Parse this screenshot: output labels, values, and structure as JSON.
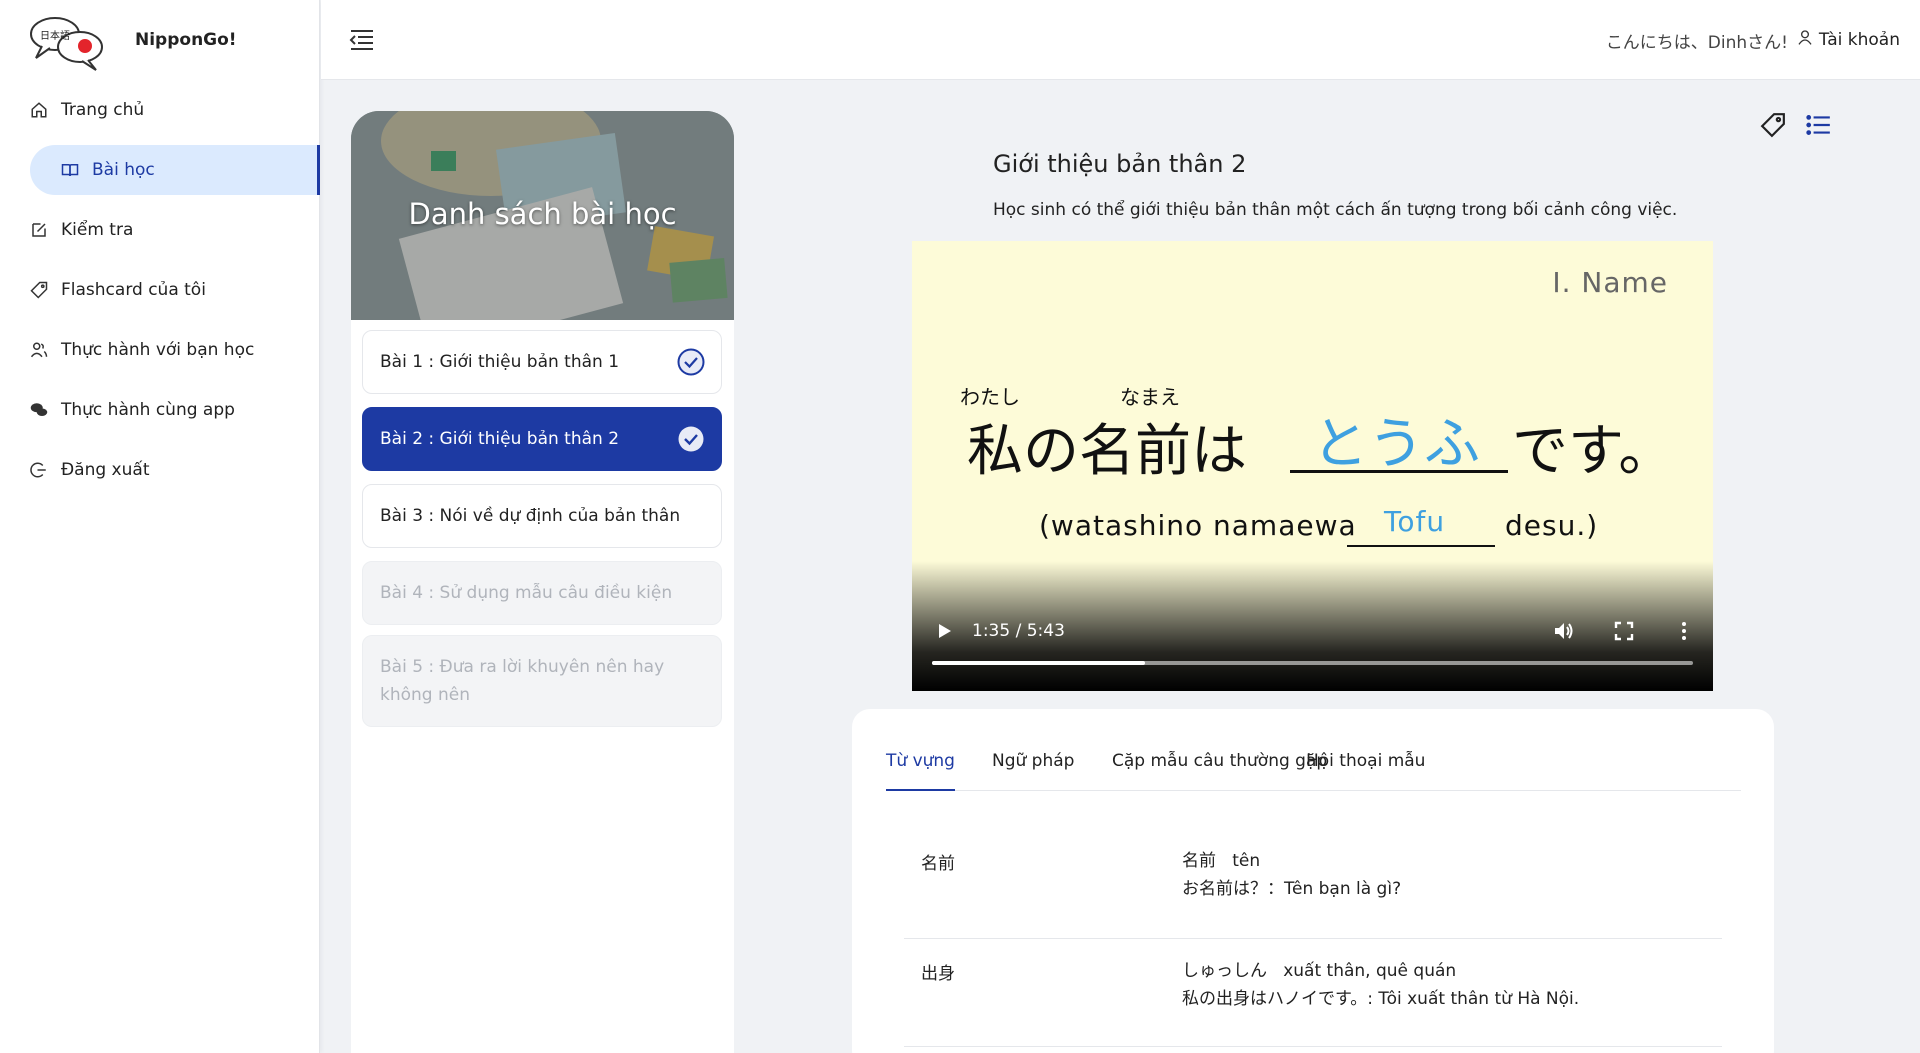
{
  "app": {
    "name": "NipponGo!",
    "logo_text": "日本語"
  },
  "sidebar": {
    "items": [
      {
        "label": "Trang chủ",
        "icon": "home-icon"
      },
      {
        "label": "Bài học",
        "icon": "book-icon",
        "active": true
      },
      {
        "label": "Kiểm tra",
        "icon": "edit-icon"
      },
      {
        "label": "Flashcard của tôi",
        "icon": "tag-icon"
      },
      {
        "label": "Thực hành với bạn học",
        "icon": "users-icon"
      },
      {
        "label": "Thực hành cùng app",
        "icon": "chat-icon"
      },
      {
        "label": "Đăng xuất",
        "icon": "logout-icon"
      }
    ]
  },
  "header": {
    "greeting": "こんにちは、Dinhさん!",
    "account_label": "Tài khoản"
  },
  "lesson_list": {
    "title": "Danh sách bài học",
    "lessons": [
      {
        "label": "Bài 1 : Giới thiệu bản thân 1",
        "status": "completed"
      },
      {
        "label": "Bài 2 : Giới thiệu bản thân 2",
        "status": "current"
      },
      {
        "label": "Bài 3 : Nói về dự định của bản thân",
        "status": "available"
      },
      {
        "label": "Bài 4 : Sử dụng mẫu câu điều kiện",
        "status": "locked"
      },
      {
        "label": "Bài 5 : Đưa ra lời khuyên nên hay không nên",
        "status": "locked"
      }
    ]
  },
  "lesson": {
    "title": "Giới thiệu bản thân 2",
    "description": "Học sinh có thể giới thiệu bản thân một cách ấn tượng trong bối cảnh công việc."
  },
  "video": {
    "slide_heading": "I. Name",
    "furigana_1": "わたし",
    "furigana_2": "なまえ",
    "sentence_start": "私の名前は",
    "answer": "とうふ",
    "sentence_end": "です。",
    "romaji_start": "(watashino namaewa",
    "romaji_answer": "Tofu",
    "romaji_end": "desu.)",
    "time": "1:35 / 5:43",
    "progress": 0.28
  },
  "tabs": [
    "Từ vựng",
    "Ngữ pháp",
    "Cặp mẫu câu thường gặp",
    "Hội thoại mẫu"
  ],
  "vocabulary": [
    {
      "word": "名前",
      "reading": "名前",
      "meaning": "tên",
      "example": "お名前は？：Tên bạn là gì?"
    },
    {
      "word": "出身",
      "reading": "しゅっしん",
      "meaning": "xuất thân, quê quán",
      "example": "私の出身はハノイです。: Tôi xuất thân từ Hà Nội."
    }
  ],
  "colors": {
    "primary": "#1d3aa3",
    "active_bg": "#dbeafe",
    "answer_blue": "#3ea0e0",
    "slide_bg": "#fdfbd8"
  }
}
